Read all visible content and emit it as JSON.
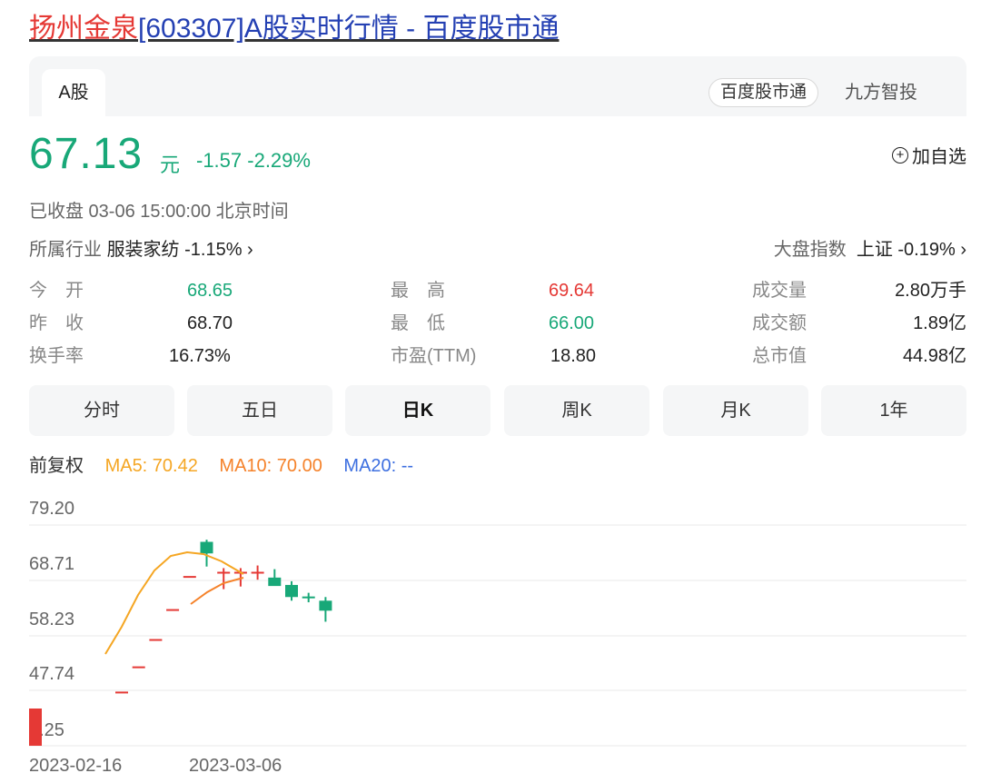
{
  "header": {
    "title_highlight": "扬州金泉",
    "title_rest": "[603307]A股实时行情 - 百度股市通"
  },
  "tabs": {
    "active": "A股"
  },
  "source": {
    "primary": "百度股市通",
    "secondary": "九方智投"
  },
  "quote": {
    "price": "67.13",
    "unit": "元",
    "change": "-1.57 -2.29%",
    "add_watchlist": "加自选",
    "status": "已收盘  03-06 15:00:00  北京时间",
    "industry_label": "所属行业",
    "industry_value": "服装家纺 -1.15% ›",
    "market_label": "大盘指数",
    "market_value": "上证 -0.19% ›"
  },
  "stats": {
    "open_label": "今　开",
    "open": "68.65",
    "prev_close_label": "昨　收",
    "prev_close": "68.70",
    "turnover_rate_label": "换手率",
    "turnover_rate": "16.73%",
    "high_label": "最　高",
    "high": "69.64",
    "low_label": "最　低",
    "low": "66.00",
    "pe_label": "市盈(TTM)",
    "pe": "18.80",
    "volume_label": "成交量",
    "volume": "2.80万手",
    "amount_label": "成交额",
    "amount": "1.89亿",
    "mktcap_label": "总市值",
    "mktcap": "44.98亿"
  },
  "periods": [
    "分时",
    "五日",
    "日K",
    "周K",
    "月K",
    "1年"
  ],
  "active_period": "日K",
  "ma": {
    "adj": "前复权",
    "ma5": "MA5: 70.42",
    "ma10": "MA10: 70.00",
    "ma20": "MA20: --",
    "ma5_color": "#f5a623",
    "ma10_color": "#f5822a",
    "ma20_color": "#3d6fe0"
  },
  "chart_data": {
    "type": "candlestick",
    "y_ticks": [
      "79.20",
      "68.71",
      "58.23",
      "47.74",
      "7.25"
    ],
    "x_ticks": [
      "2023-02-16",
      "2023-03-06"
    ],
    "candles": [
      {
        "o": 47.5,
        "h": 47.5,
        "l": 47.5,
        "c": 47.5,
        "color": "#e53935"
      },
      {
        "o": 52.3,
        "h": 52.3,
        "l": 52.3,
        "c": 52.3,
        "color": "#e53935"
      },
      {
        "o": 57.5,
        "h": 57.5,
        "l": 57.5,
        "c": 57.5,
        "color": "#e53935"
      },
      {
        "o": 63.2,
        "h": 63.2,
        "l": 63.2,
        "c": 63.2,
        "color": "#e53935"
      },
      {
        "o": 69.5,
        "h": 69.5,
        "l": 69.5,
        "c": 69.5,
        "color": "#e53935"
      },
      {
        "o": 76.0,
        "h": 76.4,
        "l": 71.3,
        "c": 73.8,
        "color": "#18a878"
      },
      {
        "o": 70.3,
        "h": 71.0,
        "l": 67.0,
        "c": 70.3,
        "color": "#e53935"
      },
      {
        "o": 70.3,
        "h": 71.0,
        "l": 67.5,
        "c": 70.3,
        "color": "#e53935"
      },
      {
        "o": 70.3,
        "h": 71.5,
        "l": 68.8,
        "c": 70.3,
        "color": "#e53935"
      },
      {
        "o": 69.2,
        "h": 70.8,
        "l": 67.8,
        "c": 67.6,
        "color": "#18a878"
      },
      {
        "o": 67.8,
        "h": 68.5,
        "l": 64.8,
        "c": 65.5,
        "color": "#18a878"
      },
      {
        "o": 65.6,
        "h": 66.3,
        "l": 64.5,
        "c": 65.3,
        "color": "#18a878"
      },
      {
        "o": 64.8,
        "h": 65.5,
        "l": 60.8,
        "c": 62.9,
        "color": "#18a878"
      }
    ],
    "ma5": [
      null,
      null,
      null,
      null,
      49.3,
      56.0,
      62.6,
      66.6,
      68.6,
      69.2,
      68.6,
      67.4,
      65.9
    ],
    "ma10": [
      null,
      null,
      null,
      null,
      null,
      null,
      null,
      null,
      null,
      58.7,
      60.6,
      62.4,
      64.1
    ],
    "volume_bar": {
      "color": "#e53935"
    }
  }
}
